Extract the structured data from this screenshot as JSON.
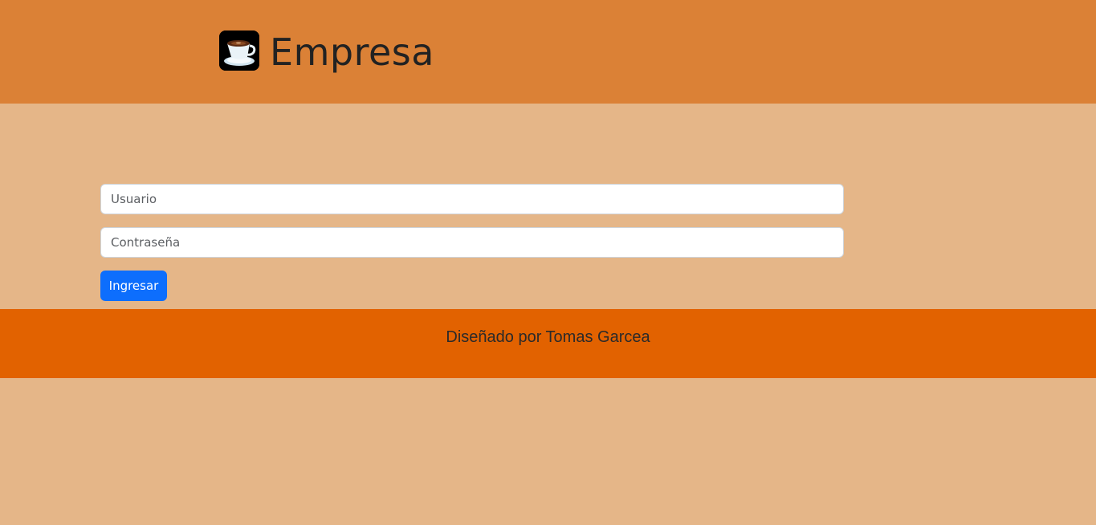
{
  "header": {
    "brand": "Empresa",
    "logo_icon": "coffee-cup-icon"
  },
  "login": {
    "username_placeholder": "Usuario",
    "password_placeholder": "Contraseña",
    "submit_label": "Ingresar"
  },
  "footer": {
    "credit": "Diseñado por Tomas Garcea"
  },
  "colors": {
    "header_bg": "#db8136",
    "page_bg": "#e5b688",
    "footer_bg": "#e26200",
    "button_bg": "#0d6efd"
  }
}
